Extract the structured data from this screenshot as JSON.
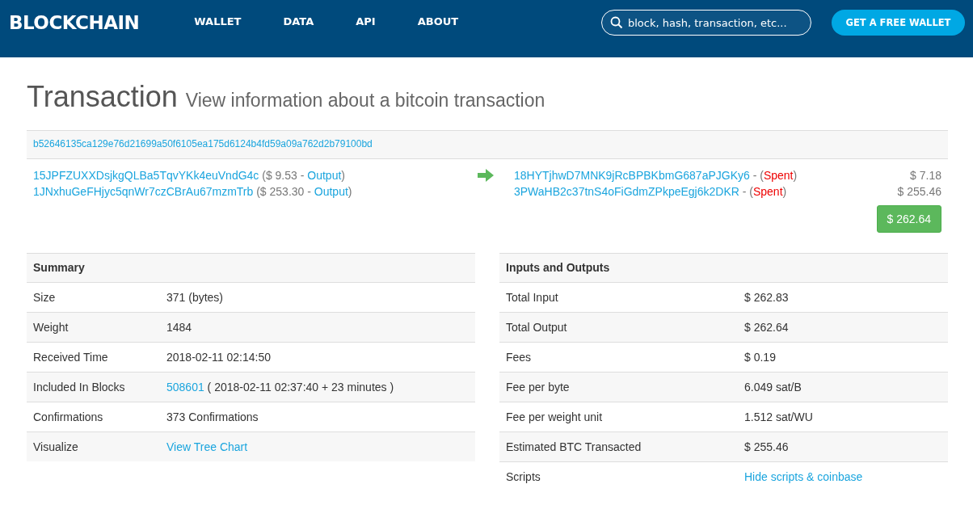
{
  "header": {
    "logo": "BLOCKCHAIN",
    "nav": [
      "WALLET",
      "DATA",
      "API",
      "ABOUT"
    ],
    "search": {
      "placeholder": "block, hash, transaction, etc..."
    },
    "cta": "GET A FREE WALLET"
  },
  "page": {
    "title": "Transaction",
    "subtitle": "View information about a bitcoin transaction"
  },
  "transaction": {
    "hash": "b52646135ca129e76d21699a50f6105ea175d6124b4fd59a09a762d2b79100bd",
    "inputs": [
      {
        "address": "15JPFZUXXDsjkgQLBa5TqvYKk4euVndG4c",
        "prefix": "($ 9.53 -",
        "link": "Output",
        "suffix": ")"
      },
      {
        "address": "1JNxhuGeFHjyc5qnWr7czCBrAu67mzmTrb",
        "prefix": "($ 253.30 -",
        "link": "Output",
        "suffix": ")"
      }
    ],
    "outputs": [
      {
        "address": "18HYTjhwD7MNK9jRcBPBKbmG687aPJGKy6",
        "prefix": "- (",
        "status": "Spent",
        "suffix": ")",
        "amount": "$ 7.18"
      },
      {
        "address": "3PWaHB2c37tnS4oFiGdmZPkpeEgj6k2DKR",
        "prefix": "- (",
        "status": "Spent",
        "suffix": ")",
        "amount": "$ 255.46"
      }
    ],
    "total": "$ 262.64"
  },
  "tables": [
    {
      "title": "Summary",
      "rows": [
        {
          "label": "Size",
          "kind": "text",
          "value": "371 (bytes)"
        },
        {
          "label": "Weight",
          "kind": "text",
          "value": "1484"
        },
        {
          "label": "Received Time",
          "kind": "text",
          "value": "2018-02-11 02:14:50"
        },
        {
          "label": "Included In Blocks",
          "kind": "mixed",
          "link": "508601",
          "value": "( 2018-02-11 02:37:40 + 23 minutes )"
        },
        {
          "label": "Confirmations",
          "kind": "text",
          "value": "373 Confirmations"
        },
        {
          "label": "Visualize",
          "kind": "link",
          "link": "View Tree Chart"
        }
      ]
    },
    {
      "title": "Inputs and Outputs",
      "rows": [
        {
          "label": "Total Input",
          "kind": "text",
          "value": "$ 262.83"
        },
        {
          "label": "Total Output",
          "kind": "text",
          "value": "$ 262.64"
        },
        {
          "label": "Fees",
          "kind": "text",
          "value": "$ 0.19"
        },
        {
          "label": "Fee per byte",
          "kind": "text",
          "value": "6.049 sat/B"
        },
        {
          "label": "Fee per weight unit",
          "kind": "text",
          "value": "1.512 sat/WU"
        },
        {
          "label": "Estimated BTC Transacted",
          "kind": "text",
          "value": "$ 255.46"
        },
        {
          "label": "Scripts",
          "kind": "link",
          "link": "Hide scripts & coinbase"
        }
      ]
    }
  ]
}
